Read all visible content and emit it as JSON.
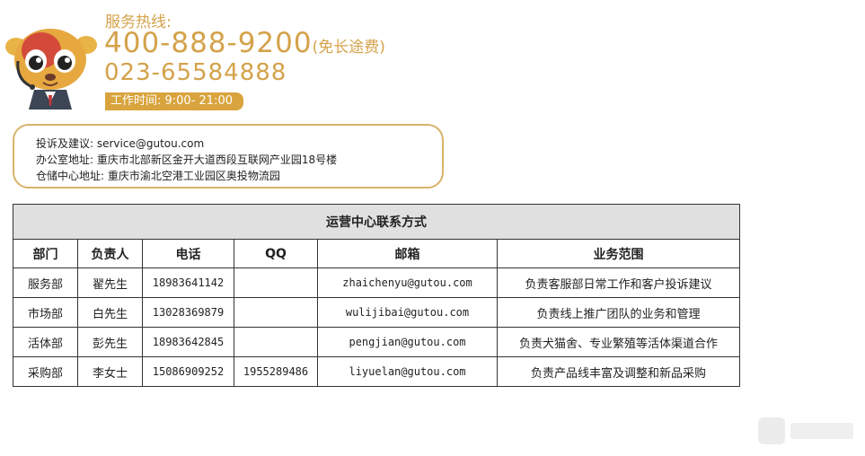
{
  "hotline": {
    "label": "服务热线:",
    "number": "400-888-9200",
    "note": "(免长途费)",
    "secondary": "023-65584888",
    "hours": "工作时间: 9:00- 21:00"
  },
  "contact": {
    "complaint": "投诉及建议: service@gutou.com",
    "office": "办公室地址: 重庆市北部新区金开大道西段互联网产业园18号楼",
    "warehouse": "仓储中心地址: 重庆市渝北空港工业园区奥投物流园"
  },
  "table": {
    "title": "运营中心联系方式",
    "headers": [
      "部门",
      "负责人",
      "电话",
      "QQ",
      "邮箱",
      "业务范围"
    ],
    "rows": [
      [
        "服务部",
        "翟先生",
        "18983641142",
        "",
        "zhaichenyu@gutou.com",
        "负责客服部日常工作和客户投诉建议"
      ],
      [
        "市场部",
        "白先生",
        "13028369879",
        "",
        "wulijibai@gutou.com",
        "负责线上推广团队的业务和管理"
      ],
      [
        "活体部",
        "彭先生",
        "18983642845",
        "",
        "pengjian@gutou.com",
        "负责犬猫舍、专业繁殖等活体渠道合作"
      ],
      [
        "采购部",
        "李女士",
        "15086909252",
        "1955289486",
        "liyuelan@gutou.com",
        "负责产品线丰富及调整和新品采购"
      ]
    ]
  },
  "icons": {
    "mascot": "dog-mascot-headset-icon",
    "watermark": "watermark-logo-icon"
  },
  "colors": {
    "accent": "#d4a24a",
    "badge": "#d9a43e",
    "box_border": "#d9b36a",
    "table_header_bg": "#e0e0e0"
  }
}
